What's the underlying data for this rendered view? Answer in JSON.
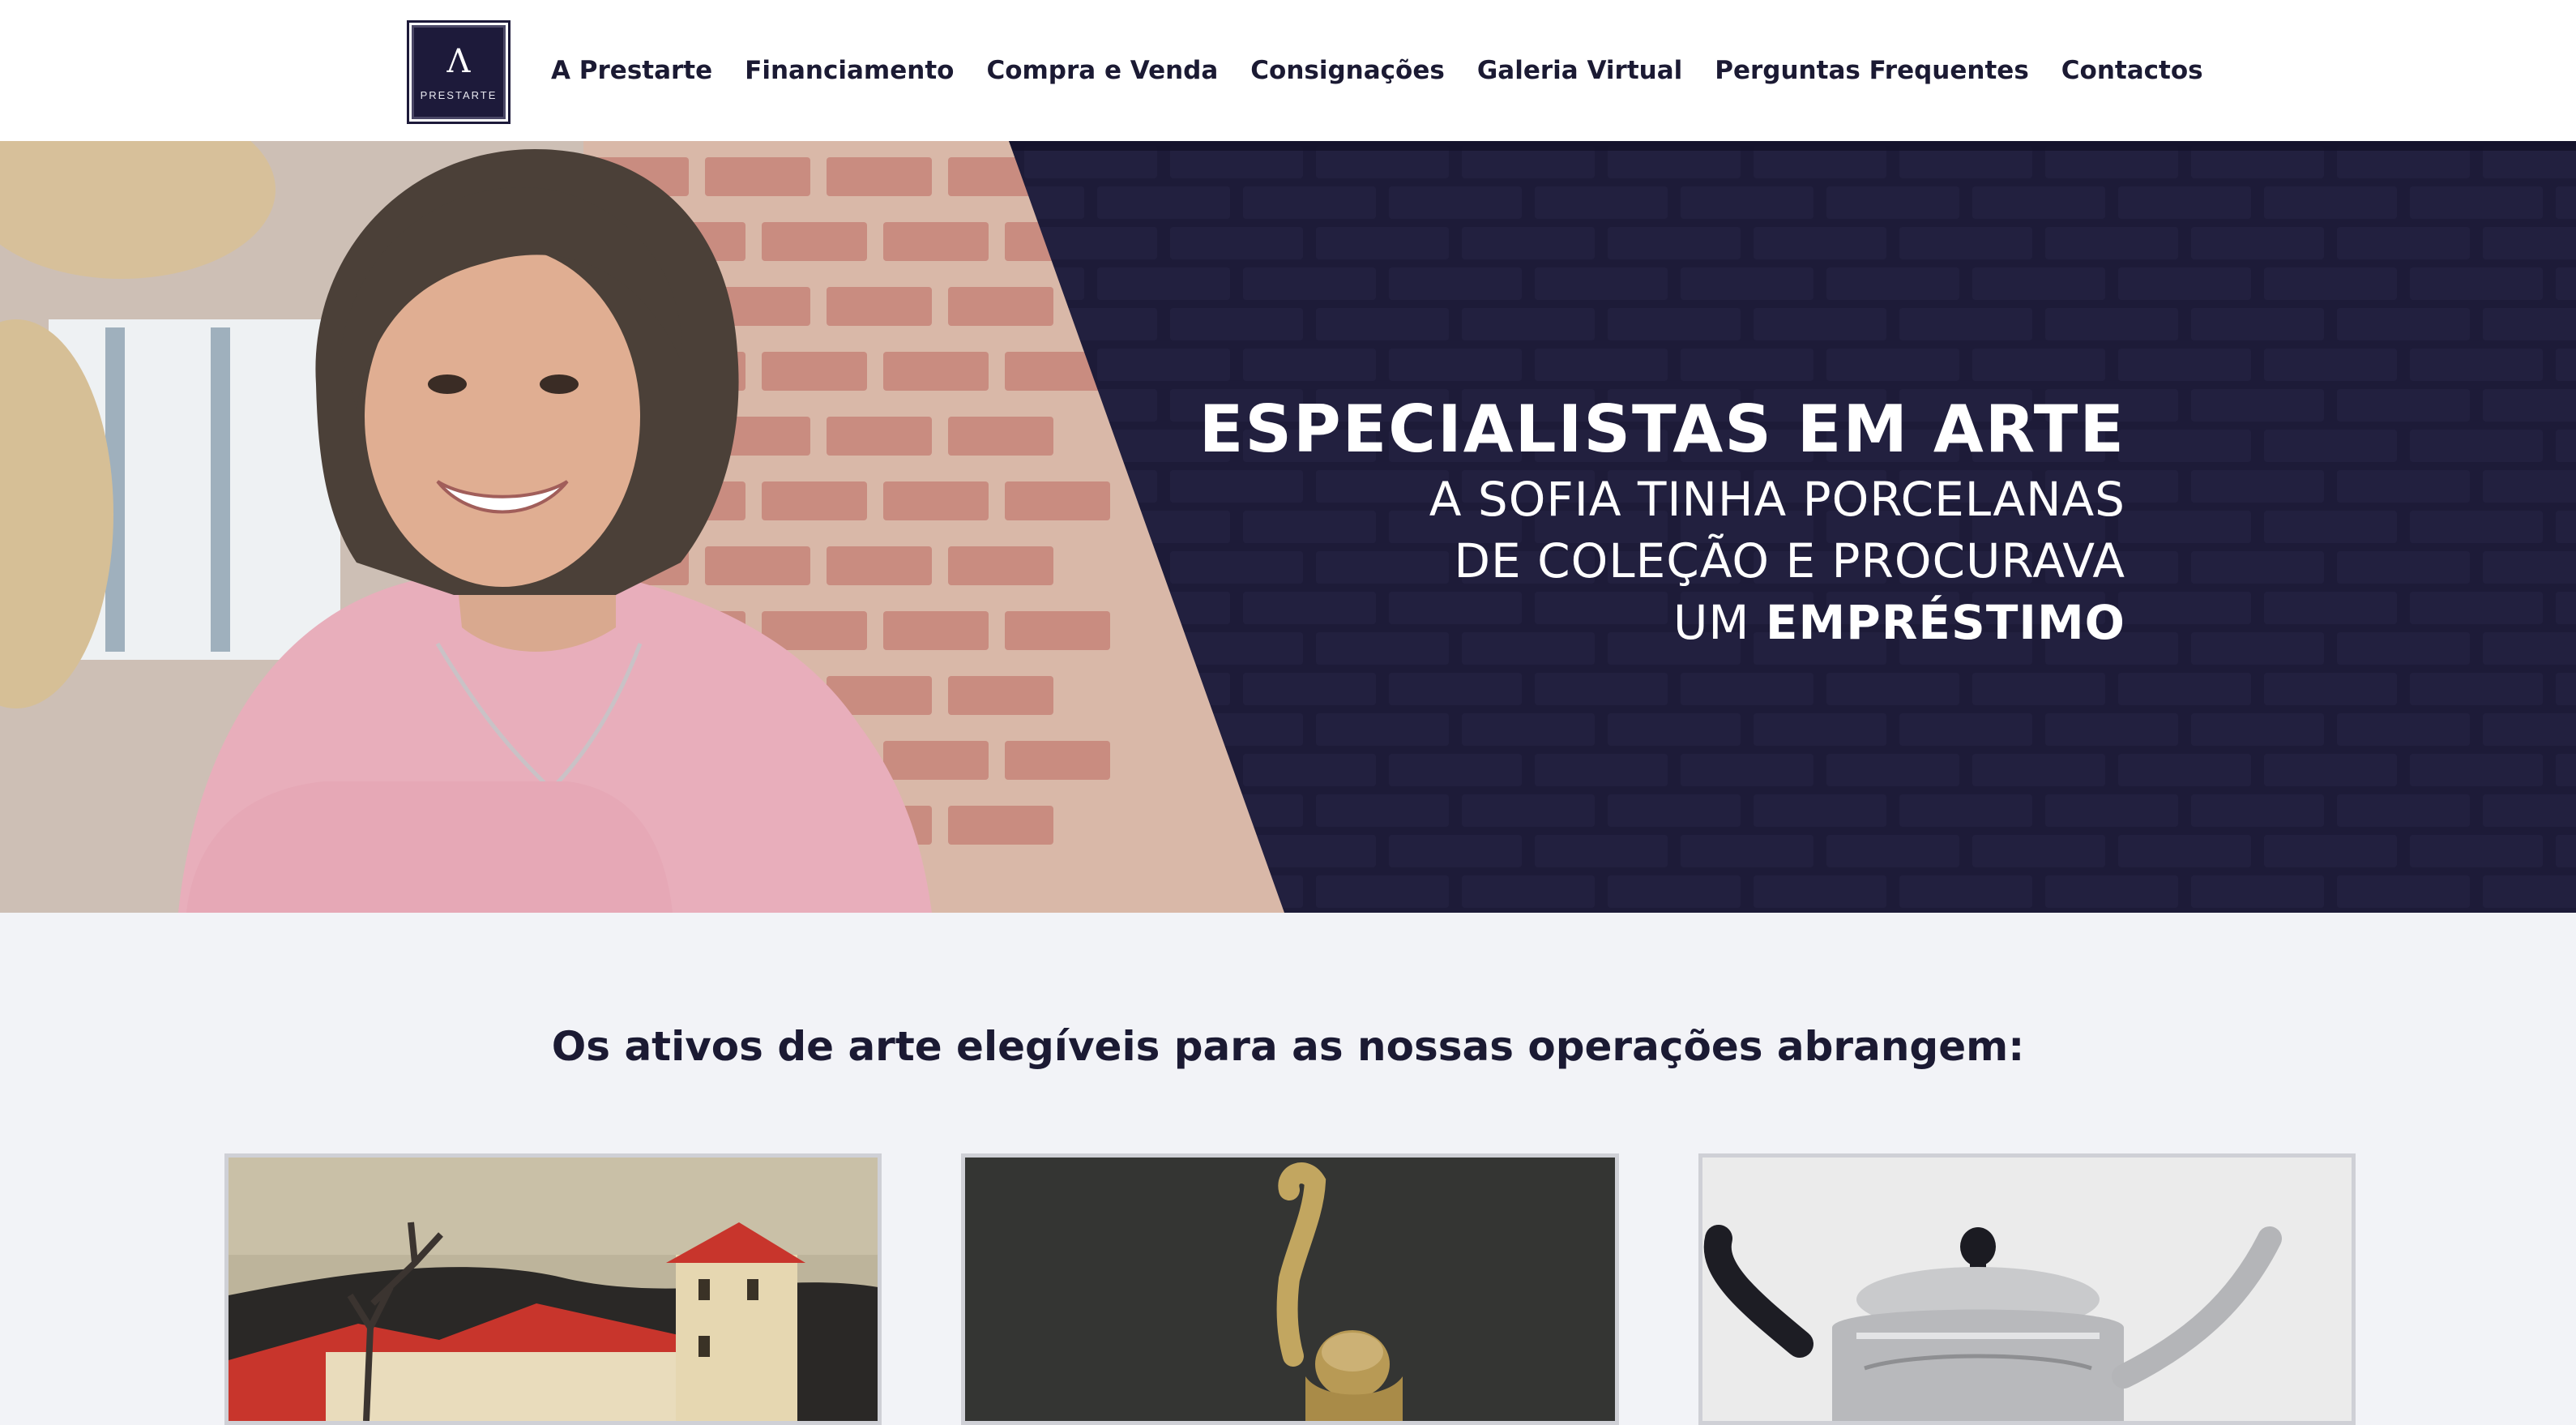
{
  "header": {
    "logo_text": "PRESTARTE",
    "logo_mark": "Λ",
    "nav": [
      "A Prestarte",
      "Financiamento",
      "Compra e Venda",
      "Consignações",
      "Galeria Virtual",
      "Perguntas Frequentes",
      "Contactos"
    ]
  },
  "hero": {
    "title": "ESPECIALISTAS EM ARTE",
    "line1": "A SOFIA TINHA PORCELANAS",
    "line2": "DE COLEÇÃO E PROCURAVA",
    "line3_prefix": "UM ",
    "line3_bold": "EMPRÉSTIMO"
  },
  "section": {
    "title": "Os ativos de arte elegíveis para as nossas operações abrangem:"
  },
  "colors": {
    "brand_dark": "#1b1a35",
    "nav_text": "#1b1a33",
    "section_bg": "#f2f3f7"
  },
  "cards": [
    {
      "icon": "painting-image"
    },
    {
      "icon": "sculpture-image"
    },
    {
      "icon": "silver-teapot-image"
    }
  ]
}
